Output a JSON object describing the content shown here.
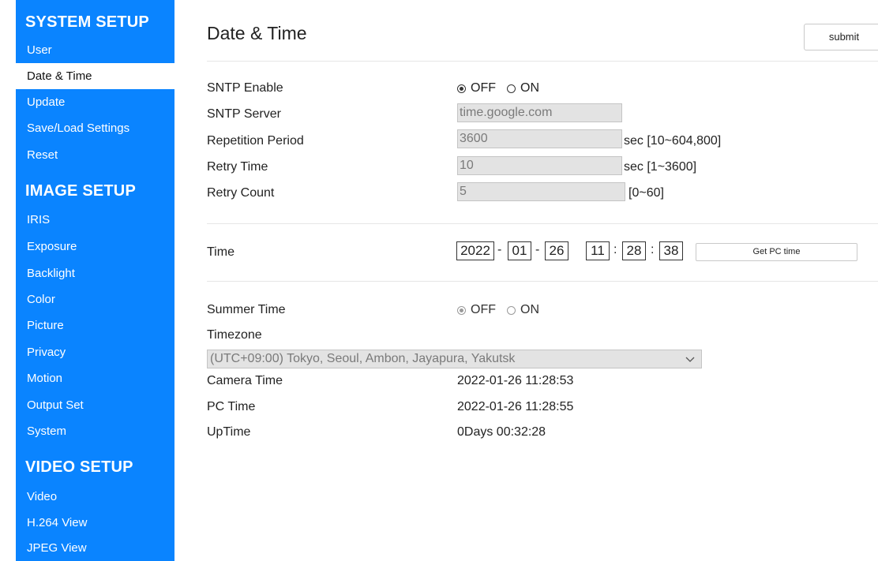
{
  "sidebar": {
    "system_setup": {
      "heading": "SYSTEM SETUP",
      "items": [
        "User",
        "Date & Time",
        "Update",
        "Save/Load Settings",
        "Reset"
      ]
    },
    "image_setup": {
      "heading": "IMAGE SETUP",
      "items": [
        "IRIS",
        "Exposure",
        "Backlight",
        "Color",
        "Picture",
        "Privacy",
        "Motion",
        "Output Set",
        "System"
      ]
    },
    "video_setup": {
      "heading": "VIDEO SETUP",
      "items": [
        "Video",
        "H.264 View",
        "JPEG View"
      ]
    },
    "active_item": "Date & Time"
  },
  "page": {
    "title": "Date & Time",
    "submit_label": "submit"
  },
  "sntp": {
    "enable_label": "SNTP Enable",
    "enable_off": "OFF",
    "enable_on": "ON",
    "enable_value": "OFF",
    "server_label": "SNTP Server",
    "server_value": "time.google.com",
    "period_label": "Repetition Period",
    "period_value": "3600",
    "period_unit": "sec [10~604,800]",
    "retry_time_label": "Retry Time",
    "retry_time_value": "10",
    "retry_time_unit": "sec [1~3600]",
    "retry_count_label": "Retry Count",
    "retry_count_value": "5",
    "retry_count_unit": "[0~60]"
  },
  "time": {
    "label": "Time",
    "year": "2022",
    "month": "01",
    "day": "26",
    "hour": "11",
    "minute": "28",
    "second": "38",
    "date_sep": "-",
    "time_sep": ":",
    "get_pc_time_label": "Get PC time"
  },
  "summer": {
    "label": "Summer Time",
    "off": "OFF",
    "on": "ON",
    "value": "OFF",
    "timezone_label": "Timezone",
    "timezone_value": "(UTC+09:00) Tokyo, Seoul, Ambon, Jayapura, Yakutsk",
    "camera_time_label": "Camera Time",
    "camera_time_value": "2022-01-26 11:28:53",
    "pc_time_label": "PC Time",
    "pc_time_value": "2022-01-26 11:28:55",
    "uptime_label": "UpTime",
    "uptime_value": "0Days 00:32:28"
  },
  "colors": {
    "sidebar_bg": "#0a84ff",
    "active_bg": "#ffffff"
  }
}
